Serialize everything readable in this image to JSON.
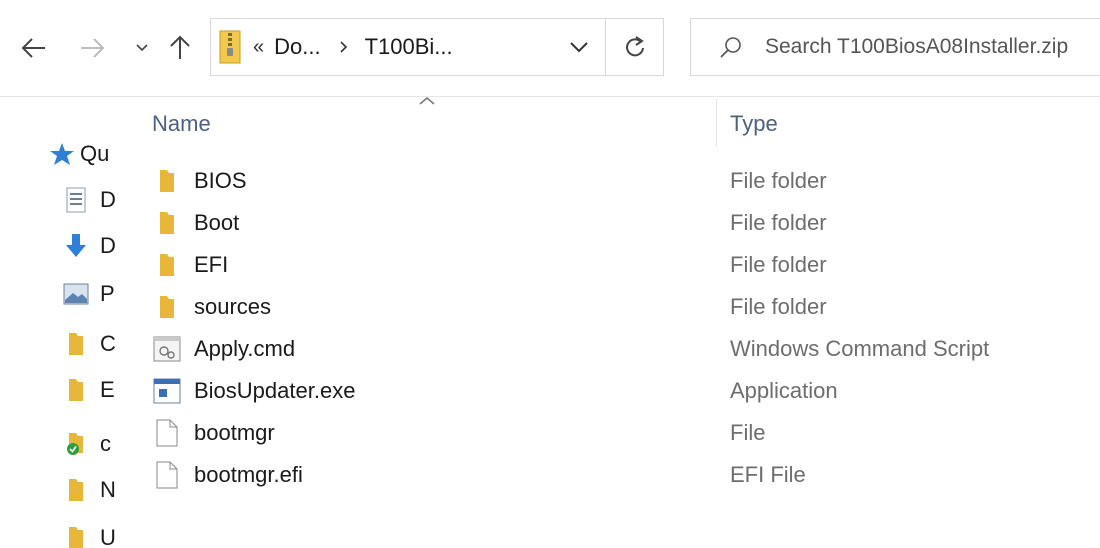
{
  "address_bar": {
    "overflow_marker": "«",
    "crumbs": [
      "Do...",
      "T100Bi..."
    ]
  },
  "search": {
    "placeholder": "Search T100BiosA08Installer.zip"
  },
  "nav_pane": {
    "items": [
      {
        "label": "Qu",
        "icon": "quick-access-star-icon"
      },
      {
        "label": "D",
        "icon": "document-icon"
      },
      {
        "label": "D",
        "icon": "download-arrow-icon"
      },
      {
        "label": "P",
        "icon": "picture-icon"
      },
      {
        "label": "C",
        "icon": "folder-icon"
      },
      {
        "label": "E",
        "icon": "folder-icon"
      },
      {
        "label": "c",
        "icon": "folder-synced-icon"
      },
      {
        "label": "N",
        "icon": "folder-icon"
      },
      {
        "label": "U",
        "icon": "folder-icon"
      }
    ]
  },
  "columns": {
    "name": "Name",
    "type": "Type"
  },
  "files": [
    {
      "name": "BIOS",
      "type": "File folder",
      "icon": "folder-icon"
    },
    {
      "name": "Boot",
      "type": "File folder",
      "icon": "folder-icon"
    },
    {
      "name": "EFI",
      "type": "File folder",
      "icon": "folder-icon"
    },
    {
      "name": "sources",
      "type": "File folder",
      "icon": "folder-icon"
    },
    {
      "name": "Apply.cmd",
      "type": "Windows Command Script",
      "icon": "script-file-icon"
    },
    {
      "name": "BiosUpdater.exe",
      "type": "Application",
      "icon": "application-icon"
    },
    {
      "name": "bootmgr",
      "type": "File",
      "icon": "blank-file-icon"
    },
    {
      "name": "bootmgr.efi",
      "type": "EFI File",
      "icon": "blank-file-icon"
    }
  ],
  "colors": {
    "folder": "#e8b73a",
    "header_text": "#4c6082",
    "type_text": "#6d6d6d",
    "accent_blue": "#2f7fd6"
  }
}
